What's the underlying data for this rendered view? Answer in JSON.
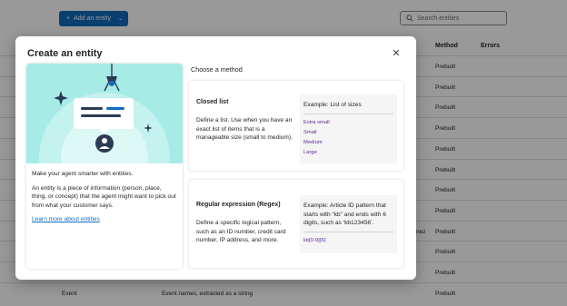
{
  "background": {
    "add_button_label": "Add an entity",
    "search_placeholder": "Search entities",
    "columns": {
      "method": "Method",
      "errors": "Errors"
    },
    "rows": [
      {
        "method": "Prebuilt"
      },
      {
        "method": "Prebuilt"
      },
      {
        "method": "Prebuilt"
      },
      {
        "method": "Prebuilt"
      },
      {
        "method": "Prebuilt"
      },
      {
        "method": "Prebuilt"
      },
      {
        "method": "Prebuilt"
      },
      {
        "method": "Prebuilt"
      },
      {
        "method": "Prebuilt"
      },
      {
        "method": "Prebuilt"
      },
      {
        "method": "Prebuilt"
      },
      {
        "method": "Prebuilt",
        "name": "Event",
        "description": "Event names, extracted as a string"
      }
    ],
    "partial_cell": "nez"
  },
  "dialog": {
    "title": "Create an entity",
    "close_icon": "close-icon",
    "intro": "Make your agent smarter with entities.",
    "explanation": "An entity is a piece of information (person, place, thing, or concept) that the agent might want to pick out from what your customer says.",
    "learn_more": "Learn more about entities",
    "choose_label": "Choose a method",
    "methods": [
      {
        "title": "Closed list",
        "description": "Define a list. Use when you have an exact list of items that is a manageable size (small to medium).",
        "example_label": "Example: List of sizes",
        "example_items": [
          "Extra small",
          "Small",
          "Medium",
          "Large"
        ]
      },
      {
        "title": "Regular expression (Regex)",
        "description": "Define a specific logical pattern, such as an ID number, credit card number, IP address, and more.",
        "example_label": "Example: Article ID pattern that starts with “kb” and ends with 6 digits, such as ‘kb123456’.",
        "example_items": [
          "kb[0-9]{6}"
        ]
      }
    ]
  },
  "colors": {
    "accent": "#0f6cbd",
    "hero_bg": "#a6ebe6",
    "example_text": "#5c2e91"
  }
}
